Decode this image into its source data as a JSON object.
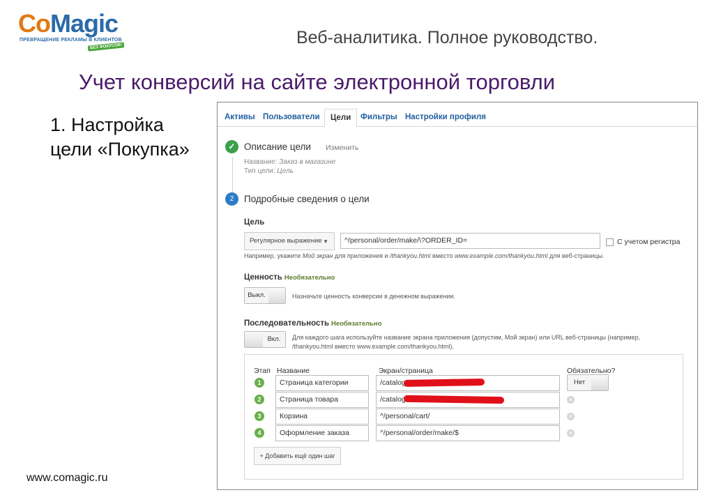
{
  "logo": {
    "co": "Co",
    "magic": "Magic",
    "tagline": "ПРЕВРАЩЕНИЕ РЕКЛАМЫ В КЛИЕНТОВ",
    "stamp": "БЕЗ ФОКУСОВ!"
  },
  "deck_title": "Веб-аналитика. Полное руководство.",
  "slide_title": "Учет конверсий на сайте электронной торговли",
  "step": {
    "line1": "1.  Настройка",
    "line2": "цели «Покупка»"
  },
  "footer_url": "www.comagic.ru",
  "tabs": [
    "Активы",
    "Пользователи",
    "Цели",
    "Фильтры",
    "Настройки профиля"
  ],
  "active_tab": "Цели",
  "section1": {
    "title": "Описание цели",
    "edit_link": "Изменить",
    "name_label": "Название:",
    "name_value": "Заказ в магазине",
    "type_label": "Тип цели:",
    "type_value": "Цель"
  },
  "section2": {
    "number": "2",
    "title": "Подробные сведения о цели",
    "goal_label": "Цель",
    "match_type": "Регулярное выражение",
    "goal_url": "^/personal/order/make/\\?ORDER_ID=",
    "case_label": "С учетом регистра",
    "goal_hint_prefix": "Например, укажите",
    "goal_hint_screen": "Мой экран",
    "goal_hint_middle": "для приложения и",
    "goal_hint_thankyou": "/thankyou.html",
    "goal_hint_instead": "вместо",
    "goal_hint_url": "www.example.com/thankyou.html",
    "goal_hint_suffix": "для веб-страницы.",
    "value_label": "Ценность",
    "optional": "Необязательно",
    "value_toggle": "Выкл.",
    "value_hint": "Назначьте ценность конверсии в денежном выражении.",
    "funnel_label": "Последовательность",
    "funnel_toggle": "Вкл.",
    "funnel_hint_line1": "Для каждого шага используйте название экрана приложения (допустим, Мой экран) или URL веб-страницы (например,",
    "funnel_hint_line2": "/thankyou.html вместо www.example.com/thankyou.html)."
  },
  "funnel": {
    "headers": {
      "step": "Этап",
      "name": "Название",
      "screen": "Экран/страница",
      "required": "Обязательно?"
    },
    "required_toggle": "Нет",
    "rows": [
      {
        "num": "1",
        "name": "Страница категории",
        "screen": "/catalog"
      },
      {
        "num": "2",
        "name": "Страница товара",
        "screen": "/catalog"
      },
      {
        "num": "3",
        "name": "Корзина",
        "screen": "^/personal/cart/"
      },
      {
        "num": "4",
        "name": "Оформление заказа",
        "screen": "^/personal/order/make/$"
      }
    ],
    "add_step": "+ Добавить ещё один шаг"
  },
  "colors": {
    "title": "#4a1a6a",
    "link": "#1f5fa0",
    "check": "#3aa14a",
    "step": "#6ab04c",
    "redaction": "#e0101a"
  }
}
